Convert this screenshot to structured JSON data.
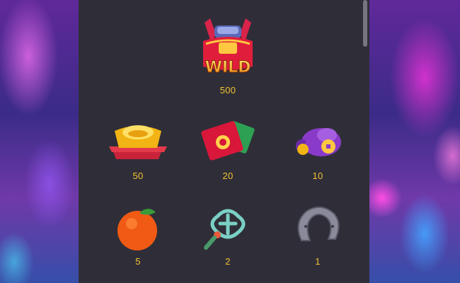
{
  "paytable": {
    "symbols": [
      {
        "id": "wild",
        "label": "WILD",
        "payout": "500",
        "icon": "wild-chariot-icon"
      },
      {
        "id": "gold",
        "payout": "50",
        "icon": "gold-ingot-icon"
      },
      {
        "id": "envelope",
        "payout": "20",
        "icon": "red-envelope-icon"
      },
      {
        "id": "bag",
        "payout": "10",
        "icon": "coin-bag-icon"
      },
      {
        "id": "orange",
        "payout": "5",
        "icon": "mandarin-orange-icon"
      },
      {
        "id": "knot",
        "payout": "2",
        "icon": "chinese-knot-icon"
      },
      {
        "id": "horseshoe",
        "payout": "1",
        "icon": "horseshoe-icon"
      }
    ]
  },
  "colors": {
    "payout": "#f2c232",
    "panel": "#2f2e38"
  }
}
